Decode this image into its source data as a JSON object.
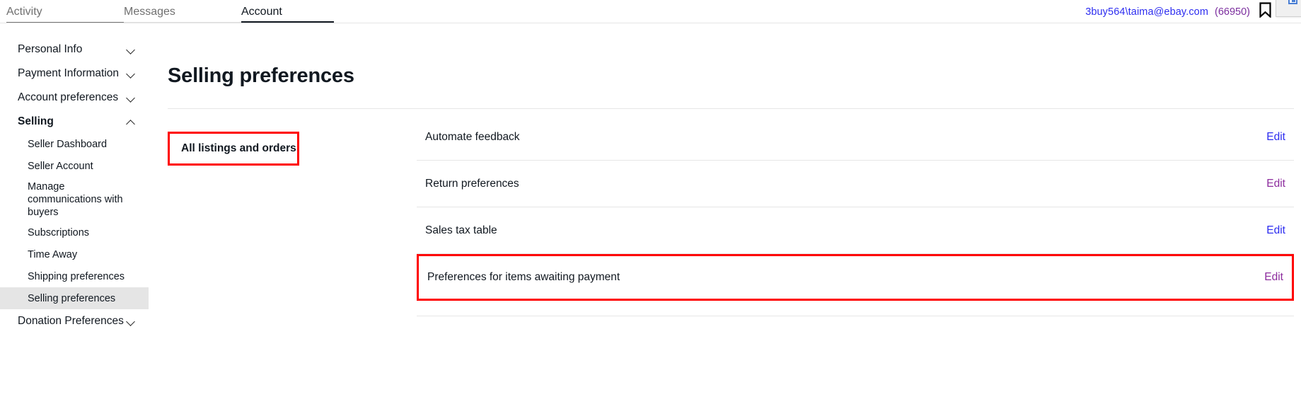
{
  "topnav": {
    "tabs": [
      {
        "label": "Activity",
        "active": false
      },
      {
        "label": "Messages",
        "active": false
      },
      {
        "label": "Account",
        "active": true
      }
    ],
    "account_email": "3buy564\\taima@ebay.com",
    "account_count": "(66950)",
    "bookmark_icon": "bookmark-icon",
    "corner_icon": "window-restore-icon"
  },
  "sidebar": {
    "groups": [
      {
        "label": "Personal Info",
        "expanded": false,
        "chevron": "chevron-down-icon"
      },
      {
        "label": "Payment Information",
        "expanded": false,
        "chevron": "chevron-down-icon"
      },
      {
        "label": "Account preferences",
        "expanded": false,
        "chevron": "chevron-down-icon"
      },
      {
        "label": "Selling",
        "expanded": true,
        "chevron": "chevron-up-icon"
      }
    ],
    "selling_items": [
      {
        "label": "Seller Dashboard",
        "selected": false
      },
      {
        "label": "Seller Account",
        "selected": false
      },
      {
        "label": "Manage communications with buyers",
        "selected": false
      },
      {
        "label": "Subscriptions",
        "selected": false
      },
      {
        "label": "Time Away",
        "selected": false
      },
      {
        "label": "Shipping preferences",
        "selected": false
      },
      {
        "label": "Selling preferences",
        "selected": true
      }
    ],
    "donation_group": {
      "label": "Donation Preferences",
      "expanded": false,
      "chevron": "chevron-down-icon"
    }
  },
  "main": {
    "page_title": "Selling preferences",
    "section_heading": "All listings and orders",
    "section_heading_highlighted": true,
    "rows": [
      {
        "label": "Automate feedback",
        "edit_label": "Edit",
        "visited": false,
        "highlighted": false
      },
      {
        "label": "Return preferences",
        "edit_label": "Edit",
        "visited": true,
        "highlighted": false
      },
      {
        "label": "Sales tax table",
        "edit_label": "Edit",
        "visited": false,
        "highlighted": false
      },
      {
        "label": "Preferences for items awaiting payment",
        "edit_label": "Edit",
        "visited": true,
        "highlighted": true
      }
    ]
  },
  "colors": {
    "link": "#2d2df0",
    "link_visited": "#8d2d9e",
    "highlight_box": "#ff0000",
    "active_tab_underline": "#111820",
    "selected_nav_bg": "#e5e5e5"
  }
}
